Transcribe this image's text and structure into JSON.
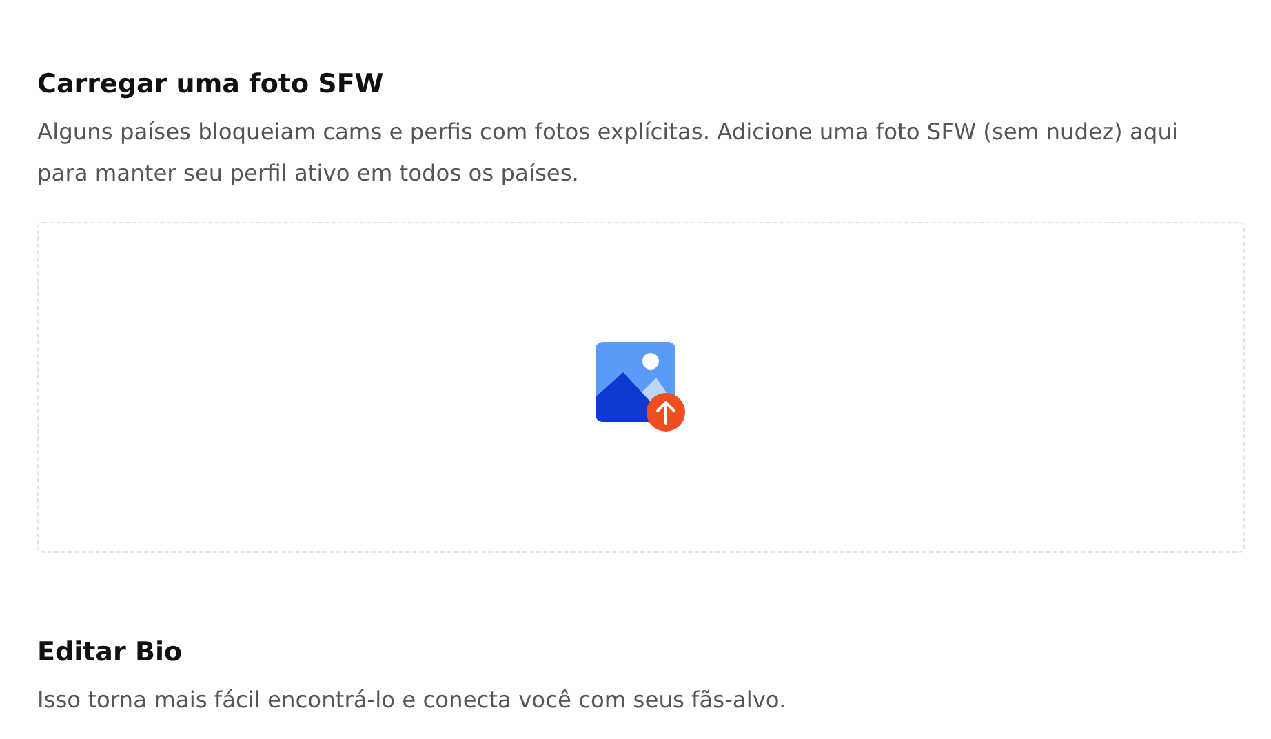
{
  "sections": [
    {
      "title": "Carregar uma foto SFW",
      "description": "Alguns países bloqueiam cams e perfis com fotos explícitas. Adicione uma foto SFW (sem nudez) aqui para manter seu perfil ativo em todos os países.",
      "upload": true
    },
    {
      "title": "Editar Bio",
      "description": "Isso torna mais fácil encontrá-lo e conecta você com seus fãs-alvo.",
      "upload": false
    }
  ]
}
